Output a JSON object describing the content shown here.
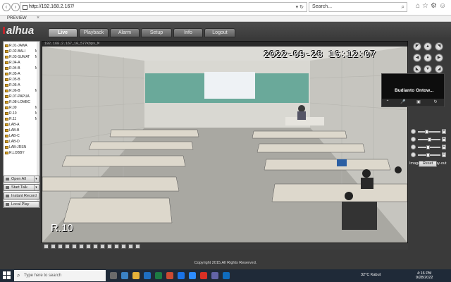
{
  "browser": {
    "url": "http://192.168.2.167/",
    "search_placeholder": "Search...",
    "tab_title": "PREVIEW"
  },
  "app": {
    "logo": "alhua",
    "menu": [
      "Live",
      "Playback",
      "Alarm",
      "Setup",
      "Info",
      "Logout"
    ],
    "active_menu": "Live"
  },
  "channels": [
    {
      "name": "R.01-JAWA",
      "mark": ""
    },
    {
      "name": "R.02-BALI",
      "mark": "M"
    },
    {
      "name": "R.03-SUMAT",
      "mark": "M"
    },
    {
      "name": "R.04-A",
      "mark": ""
    },
    {
      "name": "R.04-B",
      "mark": "M"
    },
    {
      "name": "R.05-A",
      "mark": ""
    },
    {
      "name": "R.05-B",
      "mark": ""
    },
    {
      "name": "R.06-A",
      "mark": ""
    },
    {
      "name": "R.06-B",
      "mark": "M"
    },
    {
      "name": "R.07-PAPUA",
      "mark": ""
    },
    {
      "name": "R.08-LOMBC",
      "mark": ""
    },
    {
      "name": "R.09",
      "mark": "M"
    },
    {
      "name": "R.10",
      "mark": "M"
    },
    {
      "name": "R.11",
      "mark": "M"
    },
    {
      "name": "LAB-A",
      "mark": ""
    },
    {
      "name": "LAB-B",
      "mark": ""
    },
    {
      "name": "LAB-C",
      "mark": ""
    },
    {
      "name": "LAB-D",
      "mark": ""
    },
    {
      "name": "LAB-JRSN",
      "mark": ""
    },
    {
      "name": "R.LOBBY",
      "mark": ""
    }
  ],
  "side_buttons": {
    "open_all": "Open All",
    "start_talk": "Start Talk",
    "instant_record": "Instant Record",
    "local_play": "Local Play"
  },
  "video": {
    "info": "192.168.2.167_10_577Kbps_M",
    "timestamp": "2022-09-28 16:12:07",
    "channel": "R.10"
  },
  "popup": {
    "name": "Budianto Ontow..."
  },
  "image_setup": {
    "title": "Image Setup",
    "relay": "Relay-out",
    "reset": "Reset"
  },
  "footer": {
    "copyright": "Copyright 2015,All Rights Reserved."
  },
  "taskbar": {
    "search": "Type here to search",
    "weather": "32°C  Kabut",
    "time": "4:16 PM",
    "date": "9/28/2022"
  }
}
